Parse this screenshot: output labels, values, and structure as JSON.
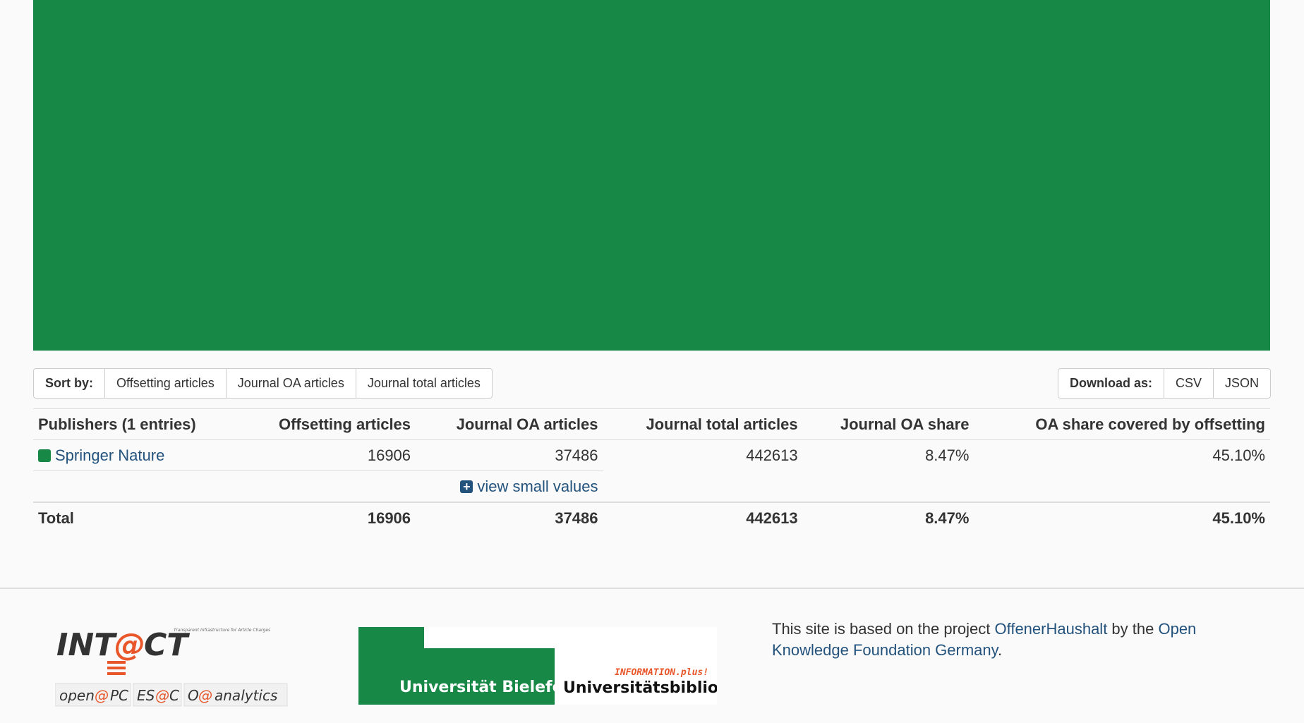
{
  "treemap": {
    "publisher": "Springer Nature",
    "color": "#188847"
  },
  "sort": {
    "label": "Sort by:",
    "options": [
      "Offsetting articles",
      "Journal OA articles",
      "Journal total articles"
    ]
  },
  "download": {
    "label": "Download as:",
    "options": [
      "CSV",
      "JSON"
    ]
  },
  "table": {
    "headers": [
      "Publishers (1 entries)",
      "Offsetting articles",
      "Journal OA articles",
      "Journal total articles",
      "Journal OA share",
      "OA share covered by offsetting"
    ],
    "rows": [
      {
        "publisher": "Springer Nature",
        "color": "#188847",
        "offsetting": "16906",
        "journal_oa": "37486",
        "journal_total": "442613",
        "oa_share": "8.47%",
        "offsetting_share": "45.10%"
      }
    ],
    "view_small_values": "view small values",
    "total": {
      "label": "Total",
      "offsetting": "16906",
      "journal_oa": "37486",
      "journal_total": "442613",
      "oa_share": "8.47%",
      "offsetting_share": "45.10%"
    }
  },
  "footer": {
    "intact_logo": {
      "title": "INTACT",
      "tagline": "Transparent Infrastructure for Article Charges",
      "sub": [
        "openAPC",
        "ESAC",
        "OA analytics"
      ]
    },
    "bielefeld_logo": {
      "university": "Universität Bielefeld",
      "info": "INFORMATION.plus!",
      "library": "Universitätsbibliothek"
    },
    "text_prefix": "This site is based on the project ",
    "link1": "OffenerHaushalt",
    "text_middle": " by the ",
    "link2": "Open Knowledge Foundation Germany",
    "text_suffix": "."
  }
}
